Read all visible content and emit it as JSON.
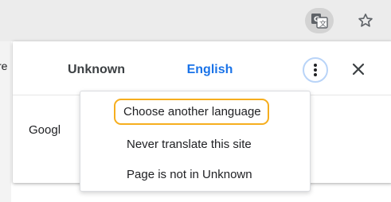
{
  "toolbar": {
    "translate_icon": "translate-icon",
    "star_icon": "star-icon"
  },
  "background_page": {
    "clipped_text": "re"
  },
  "translate_bubble": {
    "tabs": [
      {
        "label": "Unknown",
        "selected": false
      },
      {
        "label": "English",
        "selected": true
      }
    ],
    "options_icon": "more-vert-icon",
    "close_icon": "close-icon",
    "body_text": "Googl"
  },
  "options_menu": {
    "items": [
      {
        "label": "Choose another language",
        "highlighted": true
      },
      {
        "label": "Never translate this site",
        "highlighted": false
      },
      {
        "label": "Page is not in Unknown",
        "highlighted": false
      }
    ]
  },
  "colors": {
    "accent": "#1a73e8",
    "highlight_outline": "#f6ae1e",
    "toolbar_bg": "#ececec"
  }
}
